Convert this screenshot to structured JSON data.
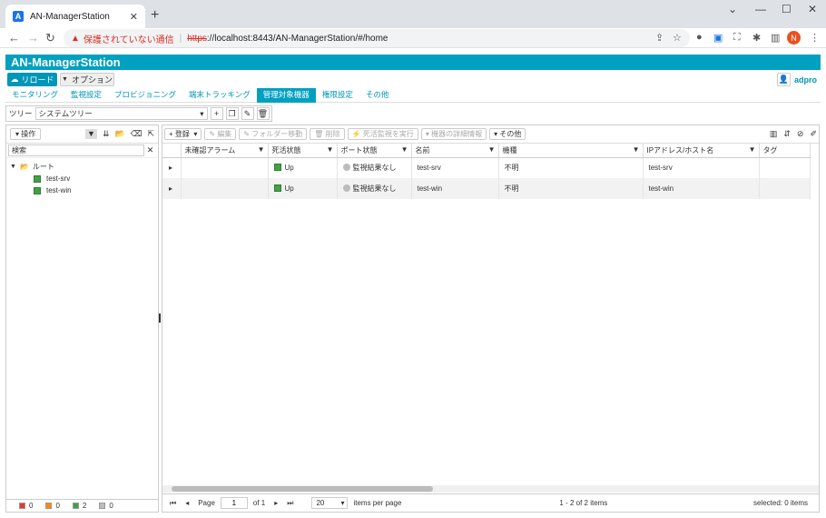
{
  "browser": {
    "tab_title": "AN-ManagerStation",
    "favicon_letter": "A",
    "security_warning": "保護されていない通信",
    "url_scheme": "https",
    "url_rest": "://localhost:8443/AN-ManagerStation/#/home",
    "profile_initial": "N"
  },
  "app": {
    "title": "AN-ManagerStation",
    "reload_label": "リロード",
    "option_label": "オプション",
    "user": "adpro"
  },
  "nav_tabs": [
    "モニタリング",
    "監視設定",
    "プロビジョニング",
    "端末トラッキング",
    "管理対象機器",
    "権限設定",
    "その他"
  ],
  "active_tab": "管理対象機器",
  "tree_bar": {
    "label": "ツリー",
    "selected": "システムツリー"
  },
  "left_panel": {
    "ops_label": "操作",
    "search_value": "検索",
    "root_label": "ルート",
    "hosts": [
      "test-srv",
      "test-win"
    ],
    "legend": [
      {
        "color": "#e53935",
        "count": "0"
      },
      {
        "color": "#fb8c00",
        "count": "0"
      },
      {
        "color": "#43a047",
        "count": "2"
      },
      {
        "color": "#bdbdbd",
        "count": "0"
      }
    ]
  },
  "right_panel": {
    "buttons": {
      "register": "登録",
      "edit": "編集",
      "move_folder": "フォルダー移動",
      "delete": "削除",
      "run_alive": "死活監視を実行",
      "device_detail": "機器の詳細情報",
      "other": "その他"
    },
    "columns": [
      "未確認アラーム",
      "死活状態",
      "ポート状態",
      "名前",
      "機種",
      "IPアドレス/ホスト名",
      "タグ"
    ],
    "rows": [
      {
        "alarm": "",
        "alive": "Up",
        "port": "監視結果なし",
        "name": "test-srv",
        "model": "不明",
        "ip": "test-srv",
        "tag": ""
      },
      {
        "alarm": "",
        "alive": "Up",
        "port": "監視結果なし",
        "name": "test-win",
        "model": "不明",
        "ip": "test-win",
        "tag": ""
      }
    ],
    "pager": {
      "page_label": "Page",
      "page_value": "1",
      "of_label": "of 1",
      "per_page": "20",
      "per_page_label": "items per page",
      "range_text": "1 - 2 of 2 items",
      "selected_text": "selected: 0 items"
    }
  }
}
